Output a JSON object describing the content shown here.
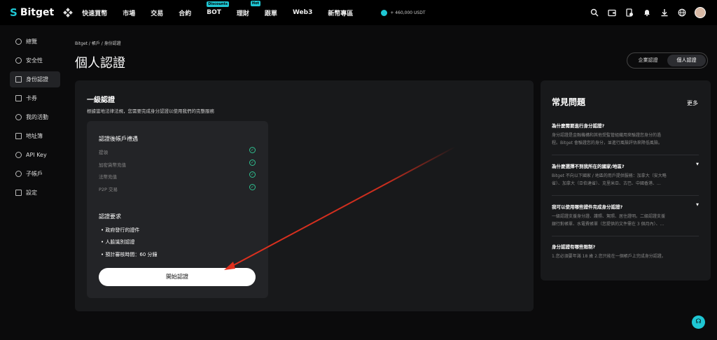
{
  "brand": {
    "name": "Bitget"
  },
  "nav": {
    "items": [
      {
        "label": "快速買幣",
        "tag": ""
      },
      {
        "label": "市場",
        "tag": ""
      },
      {
        "label": "交易",
        "tag": ""
      },
      {
        "label": "合約",
        "tag": ""
      },
      {
        "label": "BOT",
        "tag": "Discounts"
      },
      {
        "label": "理財",
        "tag": "Hot"
      },
      {
        "label": "跟單",
        "tag": ""
      },
      {
        "label": "Web3",
        "tag": ""
      },
      {
        "label": "新幣專區",
        "tag": ""
      }
    ],
    "promo": "+ 460,000 USDT",
    "icons": [
      "search-icon",
      "wallet-icon",
      "orders-icon",
      "bell-icon",
      "download-icon",
      "globe-icon"
    ]
  },
  "sidebar": {
    "items": [
      {
        "label": "總覽",
        "icon": "overview-icon"
      },
      {
        "label": "安全性",
        "icon": "shield-icon"
      },
      {
        "label": "身份認證",
        "icon": "id-card-icon"
      },
      {
        "label": "卡券",
        "icon": "coupon-icon"
      },
      {
        "label": "我的活動",
        "icon": "trophy-icon"
      },
      {
        "label": "地址簿",
        "icon": "address-book-icon"
      },
      {
        "label": "API Key",
        "icon": "key-icon"
      },
      {
        "label": "子帳戶",
        "icon": "sub-account-icon"
      },
      {
        "label": "設定",
        "icon": "settings-icon"
      }
    ]
  },
  "breadcrumb": "Bitget  /  帳戶  /  身份認證",
  "page_title": "個人認證",
  "tabs": [
    "企業認證",
    "個人認證"
  ],
  "verification": {
    "level": "一級認證",
    "subtitle": "根據當地法律法規，您需要完成身分認證以使用我們的完整服務",
    "benefits_title": "認證後帳戶禮遇",
    "benefits": [
      "提領",
      "加密貨幣充值",
      "法幣充值",
      "P2P 交易"
    ],
    "requirements_title": "認證要求",
    "requirements": [
      "• 政府發行的證件",
      "• 人臉識別認證",
      "• 預計審核時間：60 分鐘"
    ],
    "start_button": "開始認證"
  },
  "faq": {
    "title": "常見問題",
    "more": "更多",
    "items": [
      {
        "q": "為什麼需要進行身分認證?",
        "a1": "身分認證是金融機構和其他受監管組織用來驗證您身分的過",
        "a2": "程。Bitget 會驗證您的身分，並進行風險評估來降低風險。"
      },
      {
        "q": "為什麼選擇不到我所在的國家/地區?",
        "a1": "Bitget 不向以下國家 / 地區的用戶提供服務：加拿大（安大略",
        "a2": "省）、加拿大（亞伯達省）、克里米亞、古巴、中國香港、..."
      },
      {
        "q": "我可以使用哪些證件完成身分認證?",
        "a1": "一級認證支援身分證、護照、駕照、居住證明。二級認證支援",
        "a2": "銀行對帳單、水電費帳單（您提供的文件需在 3 個月內）、..."
      },
      {
        "q": "身分認證有哪些限制?",
        "a1": "1.您必須要年滿 18 歲 2.您只能在一個帳戶上完成身分認證。",
        "a2": ""
      }
    ]
  },
  "colors": {
    "accent": "#1fc7d4",
    "check": "#2fbf8f",
    "annotation": "#e0301e"
  }
}
